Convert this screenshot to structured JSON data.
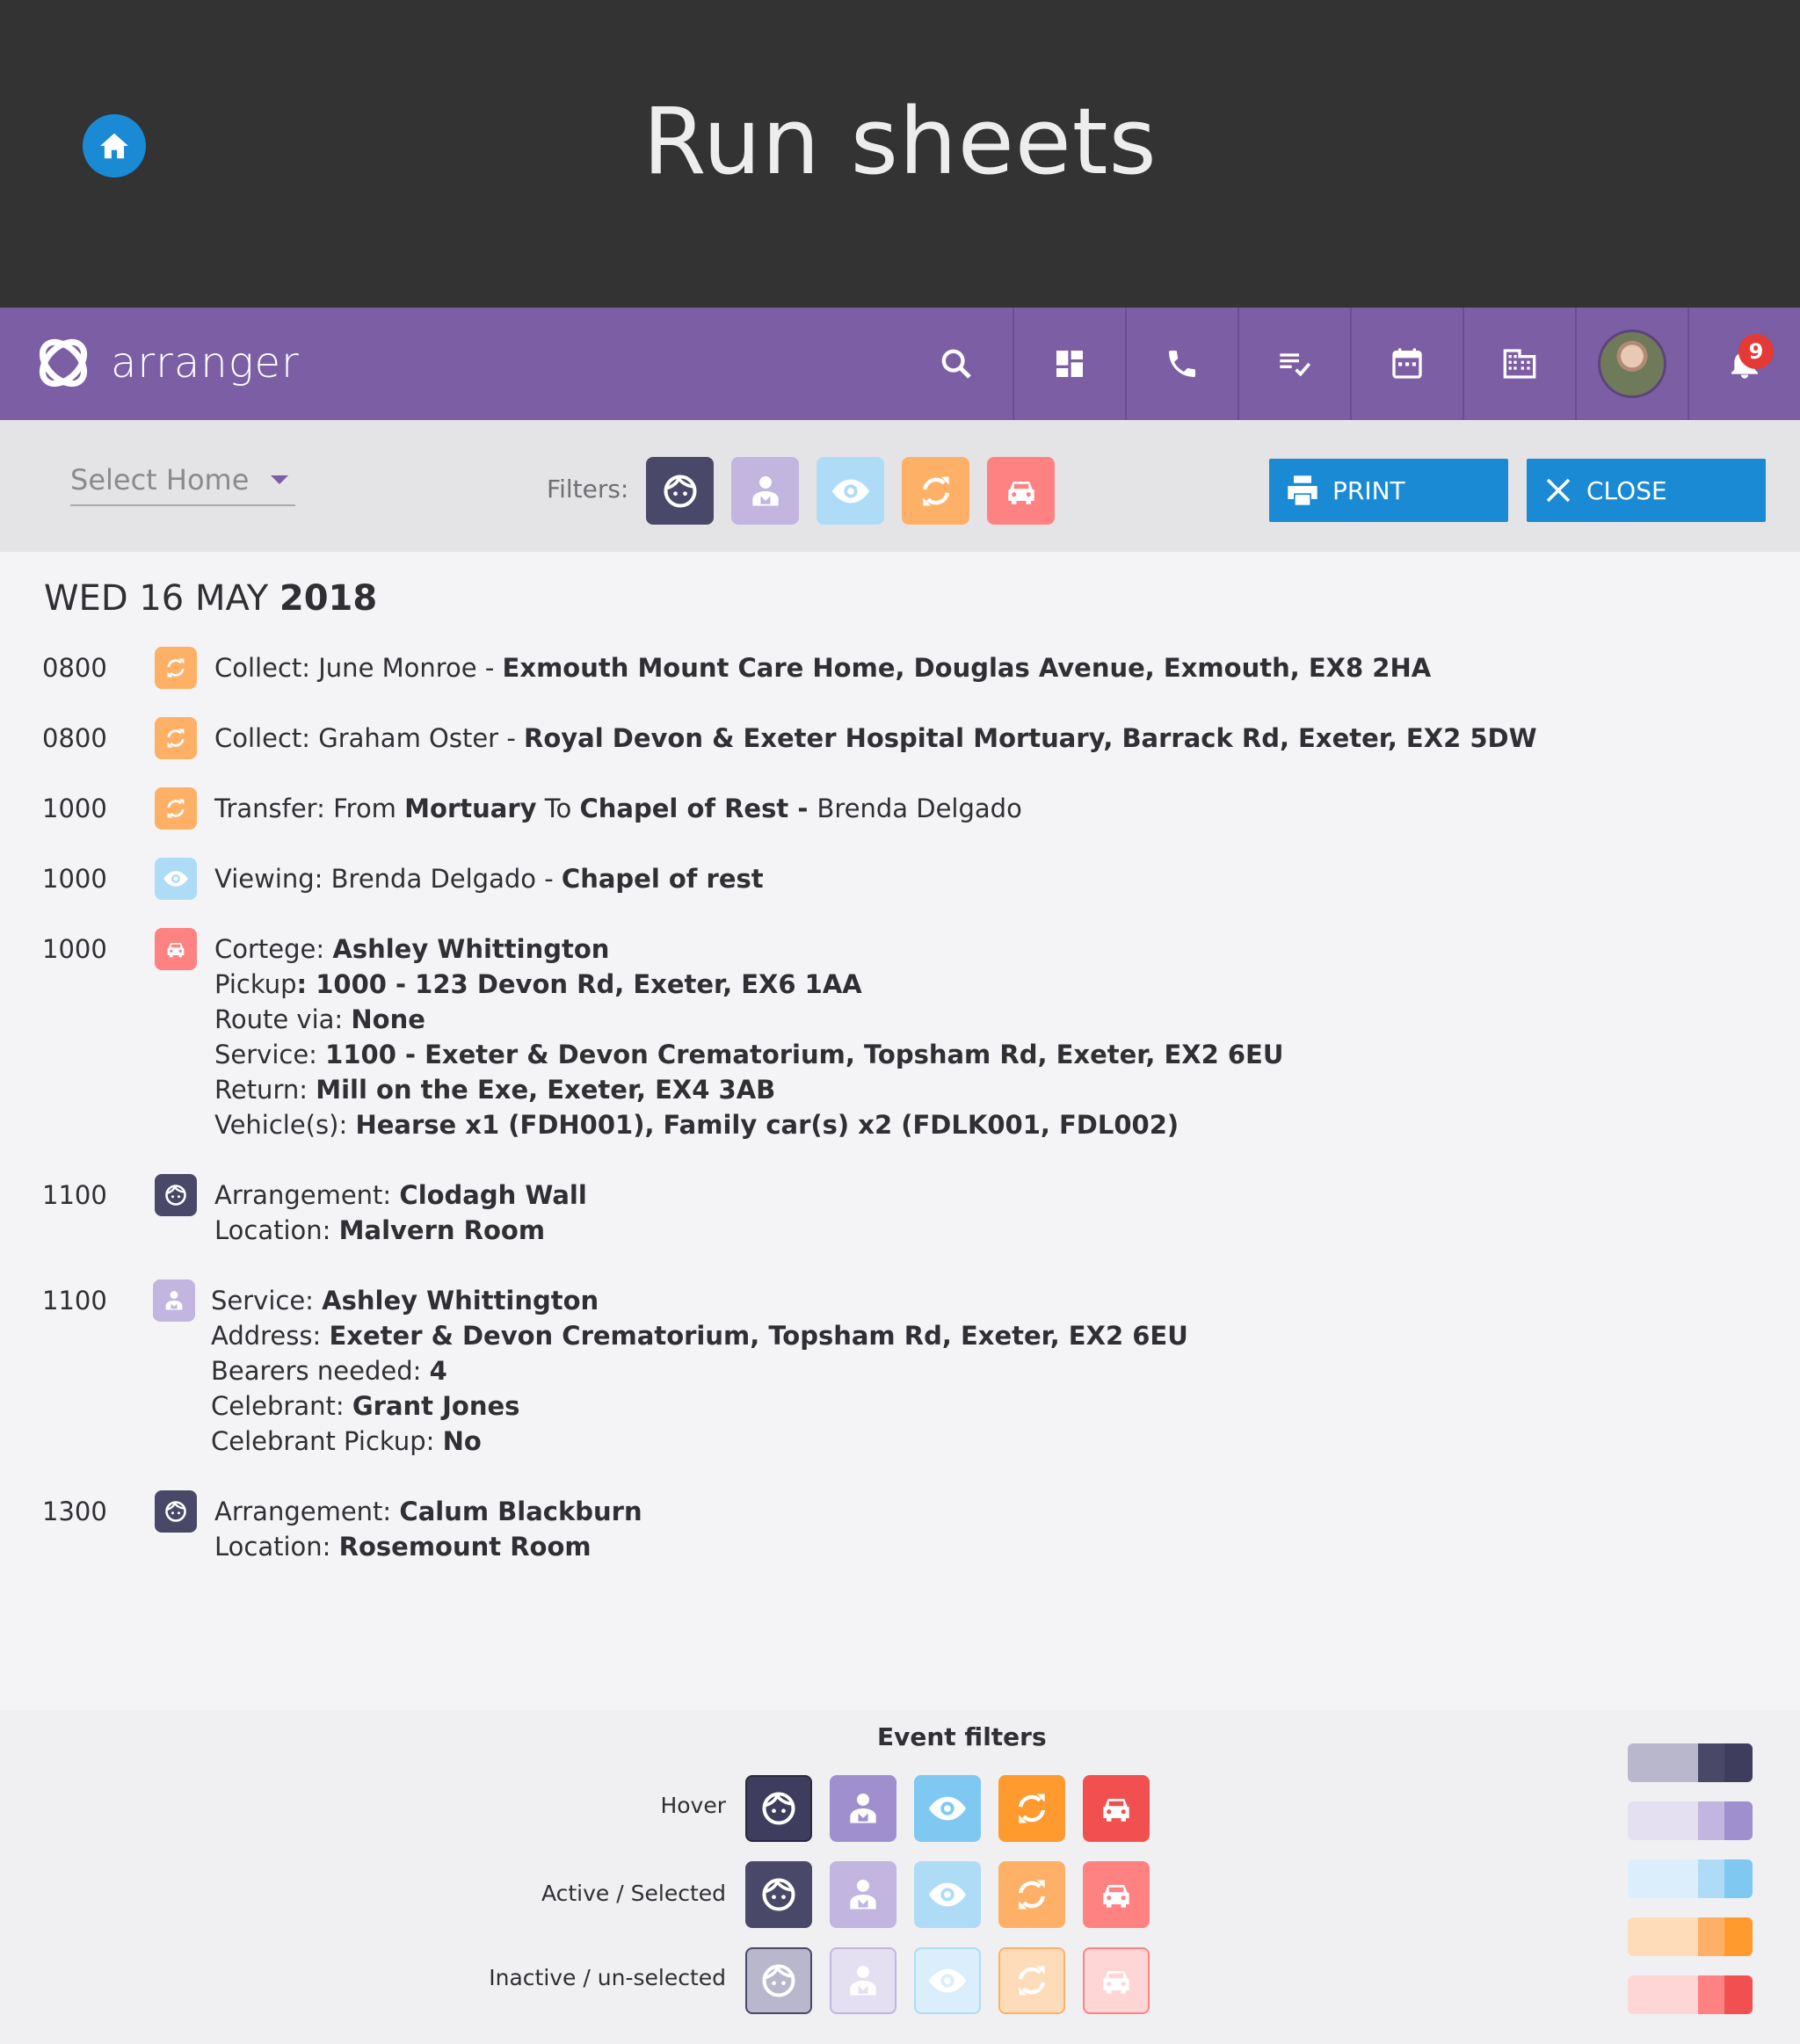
{
  "banner": {
    "title": "Run sheets"
  },
  "app": {
    "logo_text": "arranger",
    "notification_count": "9"
  },
  "toolbar": {
    "select_home_placeholder": "Select Home",
    "filters_label": "Filters:",
    "print_label": "PRINT",
    "close_label": "CLOSE"
  },
  "day": {
    "date_prefix": "WED 16 MAY ",
    "date_year": "2018"
  },
  "events": [
    {
      "time": "0800",
      "lines": [
        [
          "Collect: June Monroe - ",
          "Exmouth Mount Care Home, Douglas Avenue, Exmouth, EX8 2HA"
        ]
      ]
    },
    {
      "time": "0800",
      "lines": [
        [
          "Collect: Graham Oster - ",
          "Royal Devon & Exeter Hospital Mortuary, Barrack Rd, Exeter, EX2 5DW"
        ]
      ]
    },
    {
      "time": "1000",
      "parts": [
        "Transfer: From ",
        "Mortuary",
        " To ",
        "Chapel of Rest - ",
        "Brenda Delgado"
      ]
    },
    {
      "time": "1000",
      "lines": [
        [
          "Viewing: Brenda Delgado - ",
          "Chapel of rest"
        ]
      ]
    },
    {
      "time": "1000",
      "lines": [
        [
          "Cortege: ",
          "Ashley Whittington"
        ],
        [
          "Pickup",
          ": 1000 - 123 Devon Rd, Exeter, EX6 1AA"
        ],
        [
          "Route via: ",
          "None"
        ],
        [
          "Service: ",
          "1100 - Exeter & Devon Crematorium, Topsham Rd, Exeter, EX2 6EU"
        ],
        [
          "Return: ",
          "Mill on the Exe, Exeter, EX4 3AB"
        ],
        [
          "Vehicle(s): ",
          "Hearse x1 (FDH001), Family car(s) x2 (FDLK001, FDL002)"
        ]
      ]
    },
    {
      "time": "1100",
      "lines": [
        [
          "Arrangement: ",
          "Clodagh Wall"
        ],
        [
          "Location: ",
          "Malvern Room"
        ]
      ]
    },
    {
      "time": "1100",
      "lines": [
        [
          "Service: ",
          "Ashley Whittington"
        ],
        [
          "Address: ",
          "Exeter & Devon Crematorium, Topsham Rd, Exeter, EX2 6EU"
        ],
        [
          "Bearers needed: ",
          "4"
        ],
        [
          "Celebrant: ",
          "Grant Jones"
        ],
        [
          "Celebrant Pickup: ",
          "No"
        ]
      ]
    },
    {
      "time": "1300",
      "lines": [
        [
          "Arrangement: ",
          "Calum Blackburn"
        ],
        [
          "Location: ",
          "Rosemount Room"
        ]
      ]
    }
  ],
  "legend": {
    "title": "Event filters",
    "rows": [
      "Hover",
      "Active / Selected",
      "Inactive / un-selected"
    ]
  },
  "colors": {
    "arrangement": [
      "#3f3d5e",
      "#4a4868",
      "#b8b7cc"
    ],
    "service": [
      "#a08fcf",
      "#c2b5e0",
      "#e4e0f2"
    ],
    "viewing": [
      "#7ec8f2",
      "#aedcf7",
      "#daeffb"
    ],
    "transfer": [
      "#ff9a2e",
      "#ffb067",
      "#ffdcb9"
    ],
    "cortege": [
      "#f25050",
      "#ff8282",
      "#ffd6d6"
    ]
  }
}
